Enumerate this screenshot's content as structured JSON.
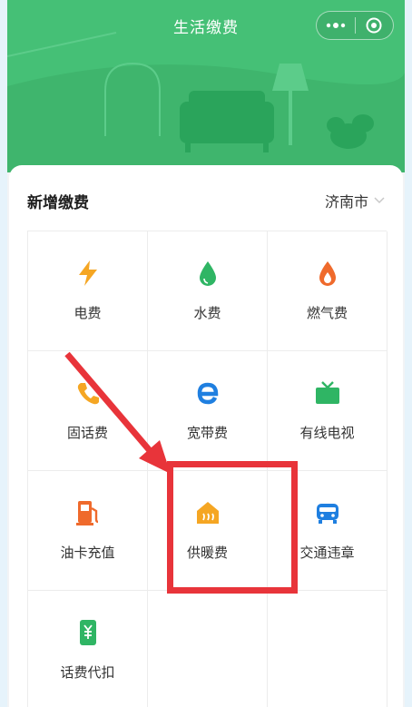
{
  "header": {
    "title": "生活缴费",
    "more_icon": "more-dots-icon",
    "close_icon": "target-icon"
  },
  "card": {
    "title": "新增缴费",
    "city": "济南市"
  },
  "services": [
    {
      "label": "电费",
      "icon": "lightning-icon",
      "color": "#f5a623"
    },
    {
      "label": "水费",
      "icon": "water-drop-icon",
      "color": "#2fb564"
    },
    {
      "label": "燃气费",
      "icon": "flame-icon",
      "color": "#ef6a2c"
    },
    {
      "label": "固话费",
      "icon": "phone-icon",
      "color": "#f5a623"
    },
    {
      "label": "宽带费",
      "icon": "browser-e-icon",
      "color": "#1f7fe0"
    },
    {
      "label": "有线电视",
      "icon": "tv-icon",
      "color": "#2fb564"
    },
    {
      "label": "油卡充值",
      "icon": "fuel-pump-icon",
      "color": "#ef6a2c"
    },
    {
      "label": "供暖费",
      "icon": "heating-house-icon",
      "color": "#f5a623"
    },
    {
      "label": "交通违章",
      "icon": "car-icon",
      "color": "#1f7fe0"
    },
    {
      "label": "话费代扣",
      "icon": "yuan-phone-icon",
      "color": "#2fb564"
    }
  ],
  "colors": {
    "header": "#45c076",
    "annotation": "#e8343a"
  }
}
